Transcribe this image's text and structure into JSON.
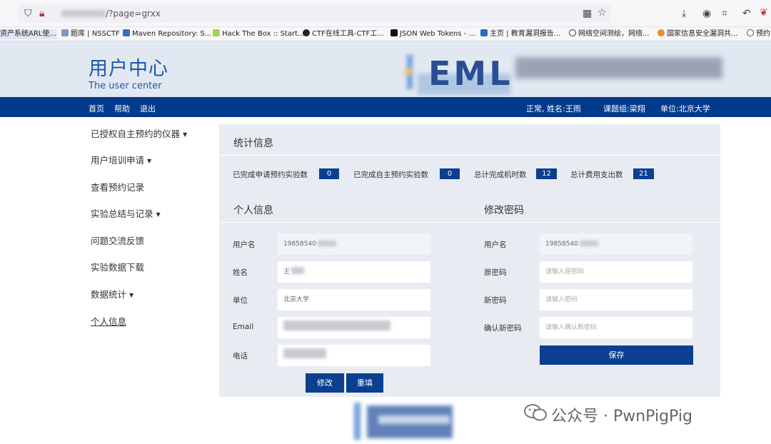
{
  "browser": {
    "url_visible": "/?page=grxx",
    "bookmarks": [
      "资产系统ARL使...",
      "题库 | NSSCTF",
      "Maven Repository: S...",
      "Hack The Box :: Start...",
      "CTF在线工具-CTF工...",
      "JSON Web Tokens - ...",
      "主页 | 教育漏洞报告...",
      "网络空间测绘，网络...",
      "国家信息安全漏洞共...",
      "预约"
    ]
  },
  "header": {
    "title": "用户中心",
    "subtitle": "The user center",
    "logo": "EML"
  },
  "nav": {
    "home": "首页",
    "help": "帮助",
    "logout": "退出",
    "status": "正常, 姓名:王雨",
    "group": "课题组:梁翔",
    "unit": "单位:北京大学"
  },
  "sidebar": {
    "items": [
      {
        "label": "已授权自主预约的仪器",
        "has_caret": true
      },
      {
        "label": "用户培训申请",
        "has_caret": true
      },
      {
        "label": "查看预约记录",
        "has_caret": false
      },
      {
        "label": "实验总结与记录",
        "has_caret": true
      },
      {
        "label": "问题交流反馈",
        "has_caret": false
      },
      {
        "label": "实验数据下载",
        "has_caret": false
      },
      {
        "label": "数据统计",
        "has_caret": true
      },
      {
        "label": "个人信息",
        "has_caret": false
      }
    ]
  },
  "stats": {
    "heading": "统计信息",
    "items": [
      {
        "label": "已完成申请预约实验数",
        "value": "0"
      },
      {
        "label": "已完成自主预约实验数",
        "value": "0"
      },
      {
        "label": "总计完成机时数",
        "value": "12"
      },
      {
        "label": "总计费用支出数",
        "value": "21"
      }
    ]
  },
  "personal": {
    "heading": "个人信息",
    "username_label": "用户名",
    "username_value": "19858540",
    "name_label": "姓名",
    "name_value": "王",
    "unit_label": "单位",
    "unit_value": "北京大学",
    "email_label": "Email",
    "phone_label": "电话",
    "modify_button": "修改",
    "reset_button": "重填"
  },
  "password": {
    "heading": "修改密码",
    "username_label": "用户名",
    "username_value": "19858540",
    "old_label": "原密码",
    "old_placeholder": "请输入原密码",
    "new_label": "新密码",
    "new_placeholder": "请输入密码",
    "confirm_label": "确认新密码",
    "confirm_placeholder": "请输入确认新密码",
    "save_button": "保存"
  },
  "watermark": {
    "text": "公众号 · PwnPigPig"
  },
  "colors": {
    "nav_bg": "#003a8c",
    "accent": "#1d58a8",
    "badge_bg": "#0b3f8f",
    "header_bg": "#e2e8f2",
    "panel_bg": "#e8ecf2"
  }
}
